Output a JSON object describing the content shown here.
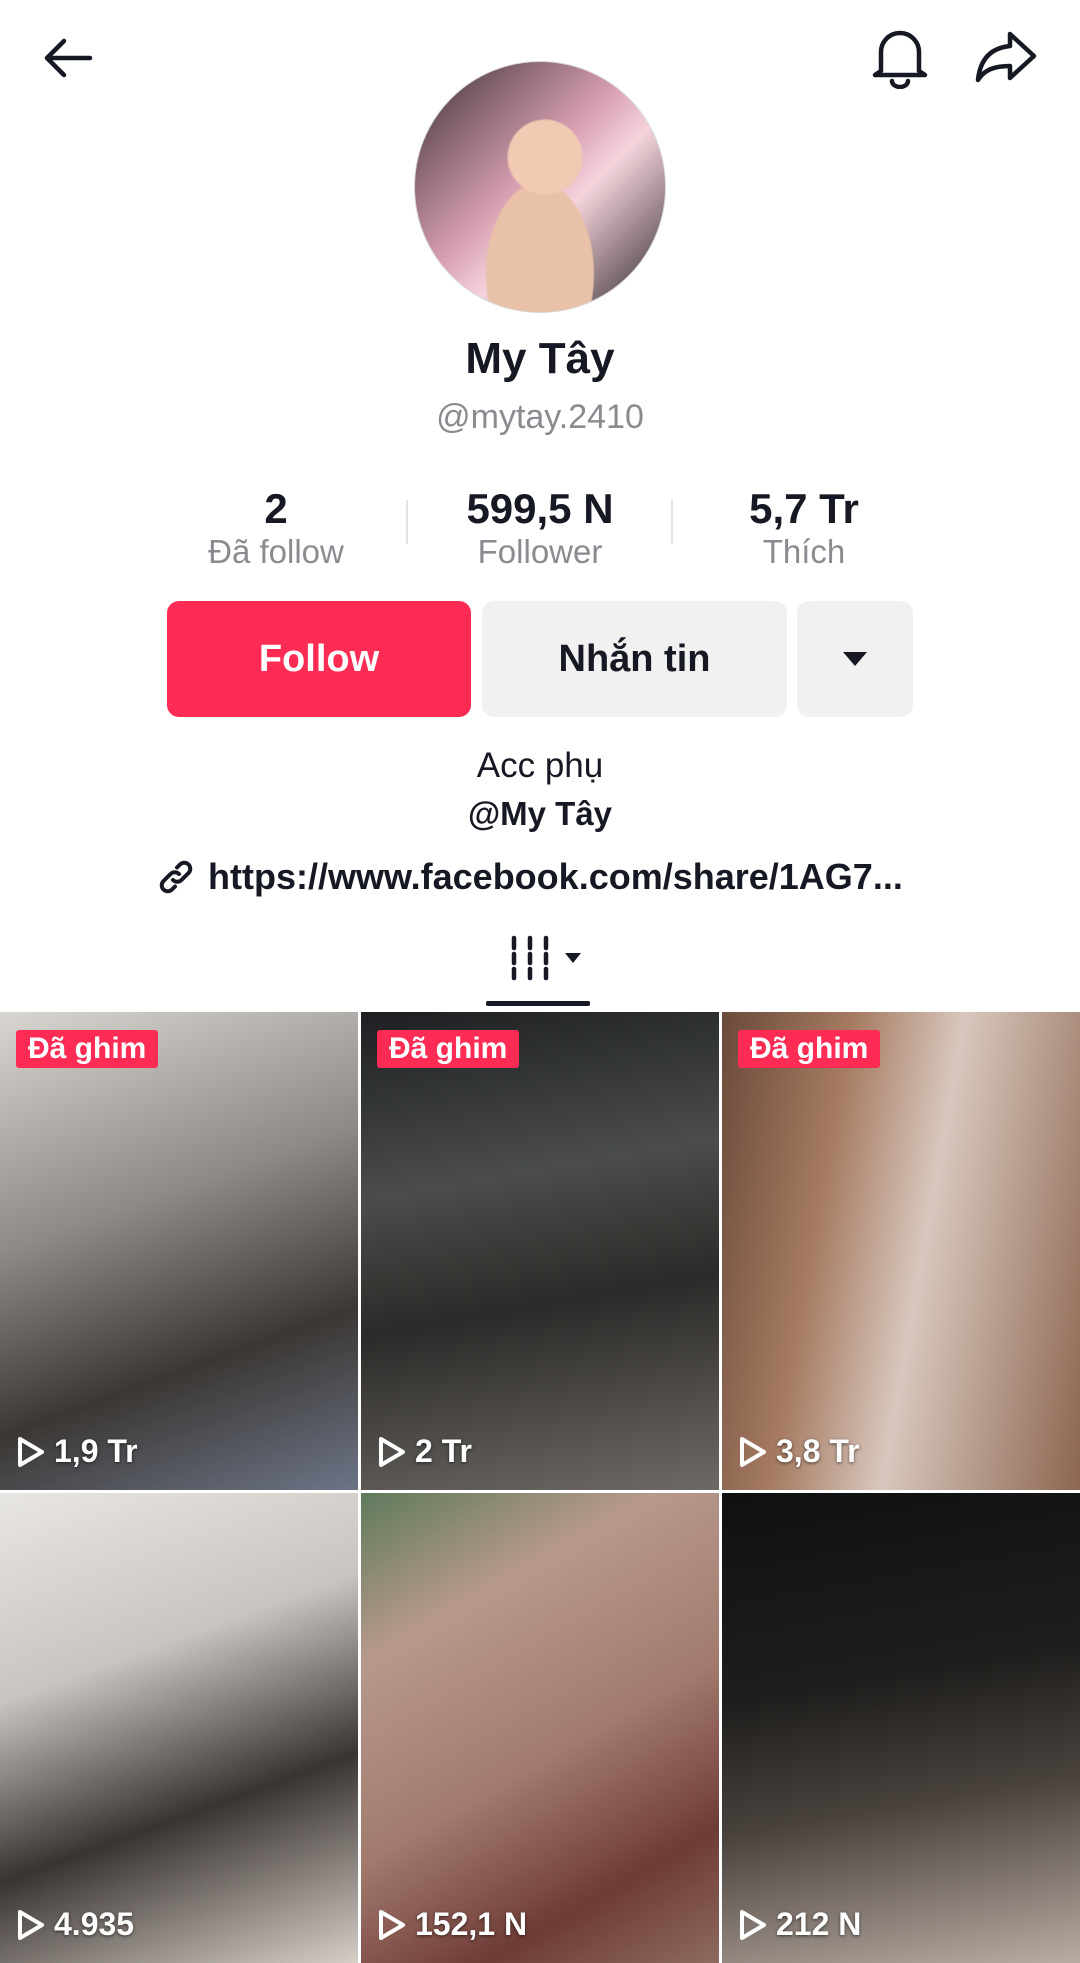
{
  "profile": {
    "name": "My Tây",
    "handle": "@mytay.2410"
  },
  "stats": [
    {
      "value": "2",
      "label": "Đã follow"
    },
    {
      "value": "599,5 N",
      "label": "Follower"
    },
    {
      "value": "5,7 Tr",
      "label": "Thích"
    }
  ],
  "actions": {
    "follow": "Follow",
    "message": "Nhắn tin"
  },
  "bio": {
    "line1": "Acc phụ",
    "line2": "@My Tây",
    "link": "https://www.facebook.com/share/1AG7..."
  },
  "videos": [
    {
      "pinned_label": "Đã ghim",
      "views": "1,9 Tr"
    },
    {
      "pinned_label": "Đã ghim",
      "views": "2 Tr"
    },
    {
      "pinned_label": "Đã ghim",
      "views": "3,8 Tr"
    },
    {
      "views": "4.935"
    },
    {
      "views": "152,1 N"
    },
    {
      "views": "212 N"
    }
  ],
  "colors": {
    "accent": "#fe2c55",
    "secondary_button": "#f1f1f2",
    "muted_text": "#8a8b91"
  },
  "icons": [
    "back-arrow-icon",
    "bell-icon",
    "share-icon",
    "link-icon",
    "grid-icon",
    "chevron-down-icon",
    "play-icon"
  ]
}
